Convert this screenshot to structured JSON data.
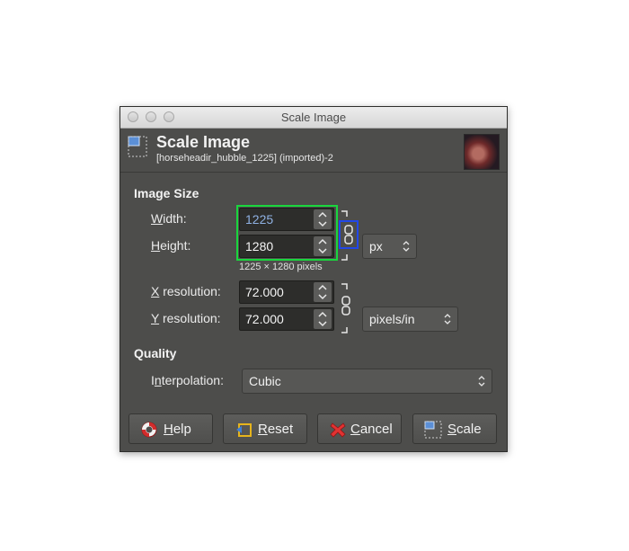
{
  "window": {
    "title": "Scale Image"
  },
  "header": {
    "title": "Scale Image",
    "subtitle": "[horseheadir_hubble_1225] (imported)-2"
  },
  "image_size": {
    "heading": "Image Size",
    "width_label_u": "W",
    "width_label_rest": "idth:",
    "width_value": "1225",
    "height_label_u": "H",
    "height_label_rest": "eight:",
    "height_value": "1280",
    "unit": "px",
    "pixels_summary": "1225 × 1280 pixels",
    "xres_label_u": "X",
    "xres_label_rest": " resolution:",
    "xres_value": "72.000",
    "yres_label_u": "Y",
    "yres_label_rest": " resolution:",
    "yres_value": "72.000",
    "res_unit": "pixels/in"
  },
  "quality": {
    "heading": "Quality",
    "interp_label_pre": "I",
    "interp_label_u": "n",
    "interp_label_rest": "terpolation:",
    "interpolation": "Cubic"
  },
  "buttons": {
    "help_u": "H",
    "help_rest": "elp",
    "reset_u": "R",
    "reset_rest": "eset",
    "cancel_u": "C",
    "cancel_rest": "ancel",
    "scale_u": "S",
    "scale_rest": "cale"
  },
  "colors": {
    "highlight_green": "#19d63d",
    "highlight_blue": "#2147e9"
  }
}
